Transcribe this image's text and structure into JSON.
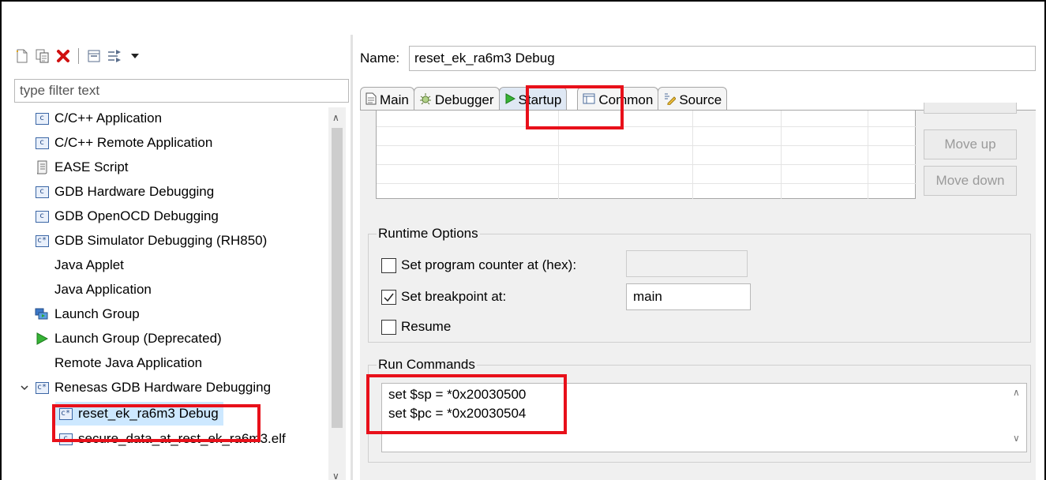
{
  "left_pane": {
    "filter_placeholder": "type filter text",
    "toolbar": {
      "icons": [
        "new-config-icon",
        "duplicate-icon",
        "delete-icon",
        "collapse-all-icon",
        "filter-icon",
        "dropdown-icon"
      ]
    },
    "tree_items": [
      {
        "label": "C/C++ Application",
        "icon": "c-config-icon"
      },
      {
        "label": "C/C++ Remote Application",
        "icon": "c-config-icon"
      },
      {
        "label": "EASE Script",
        "icon": "script-icon"
      },
      {
        "label": "GDB Hardware Debugging",
        "icon": "c-config-icon"
      },
      {
        "label": "GDB OpenOCD Debugging",
        "icon": "c-config-icon"
      },
      {
        "label": "GDB Simulator Debugging (RH850)",
        "icon": "c-config-icon"
      },
      {
        "label": "Java Applet",
        "icon": ""
      },
      {
        "label": "Java Application",
        "icon": ""
      },
      {
        "label": "Launch Group",
        "icon": "launch-group-icon"
      },
      {
        "label": "Launch Group (Deprecated)",
        "icon": "run-icon"
      },
      {
        "label": "Remote Java Application",
        "icon": ""
      },
      {
        "label": "Renesas GDB Hardware Debugging",
        "icon": "c-config-icon",
        "expanded": true
      },
      {
        "label": "reset_ek_ra6m3 Debug",
        "icon": "c-config-icon",
        "selected": true
      },
      {
        "label": "secure_data_at_rest_ek_ra6m3.elf",
        "icon": "c-config-icon"
      }
    ]
  },
  "right_pane": {
    "name_label": "Name:",
    "name_value": "reset_ek_ra6m3 Debug",
    "tabs": [
      {
        "label": "Main",
        "icon": "main-tab-icon"
      },
      {
        "label": "Debugger",
        "icon": "debugger-tab-icon"
      },
      {
        "label": "Startup",
        "icon": "startup-tab-icon",
        "active": true
      },
      {
        "label": "Common",
        "icon": "common-tab-icon"
      },
      {
        "label": "Source",
        "icon": "source-tab-icon"
      }
    ],
    "buttons": {
      "move_up": "Move up",
      "move_down": "Move down"
    },
    "runtime_options": {
      "title": "Runtime Options",
      "set_pc_label": "Set program counter at (hex):",
      "set_pc_checked": false,
      "set_pc_value": "",
      "set_bp_label": "Set breakpoint at:",
      "set_bp_checked": true,
      "set_bp_value": "main",
      "resume_label": "Resume",
      "resume_checked": false
    },
    "run_commands": {
      "title": "Run Commands",
      "lines": [
        "set $sp = *0x20030500",
        "set $pc = *0x20030504"
      ]
    }
  },
  "colors": {
    "highlight_red": "#e8101a",
    "selection_blue": "#cde8ff"
  }
}
